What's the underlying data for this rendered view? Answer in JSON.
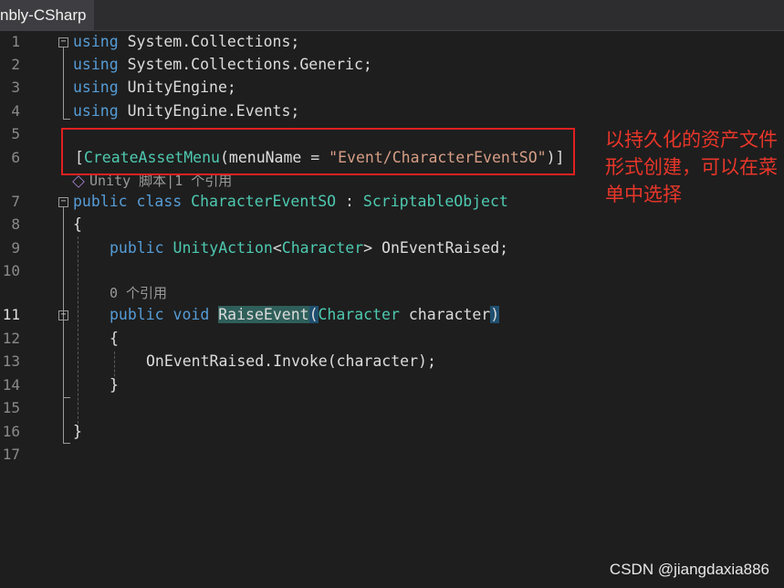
{
  "tab": {
    "title": "nbly-CSharp"
  },
  "lines": [
    {
      "n": "1"
    },
    {
      "n": "2"
    },
    {
      "n": "3"
    },
    {
      "n": "4"
    },
    {
      "n": "5"
    },
    {
      "n": "6"
    },
    {
      "n": "7"
    },
    {
      "n": "8"
    },
    {
      "n": "9"
    },
    {
      "n": "10"
    },
    {
      "n": "11"
    },
    {
      "n": "12"
    },
    {
      "n": "13"
    },
    {
      "n": "14"
    },
    {
      "n": "15"
    },
    {
      "n": "16"
    },
    {
      "n": "17"
    }
  ],
  "code": {
    "l1": {
      "kw": "using",
      "rest": " System.Collections;"
    },
    "l2": {
      "kw": "using",
      "rest": " System.Collections.Generic;"
    },
    "l3": {
      "kw": "using",
      "rest": " UnityEngine;"
    },
    "l4": {
      "kw": "using",
      "rest": " UnityEngine.Events;"
    },
    "l6": {
      "open": "[",
      "attr": "CreateAssetMenu",
      "paren": "(menuName = ",
      "str": "\"Event/CharacterEventSO\"",
      "close": ")]"
    },
    "lens1": "Unity 脚本|1 个引用",
    "l7": {
      "kw1": "public",
      "kw2": " class ",
      "name": "CharacterEventSO",
      "sep": " : ",
      "base": "ScriptableObject"
    },
    "l8": "{",
    "l9": {
      "kw": "public ",
      "ty1": "UnityAction",
      "lt": "<",
      "ty2": "Character",
      "gt": ">",
      "rest": " OnEventRaised;"
    },
    "lens2": "0 个引用",
    "l11": {
      "kw1": "public",
      "kw2": " void ",
      "name": "RaiseEvent",
      "open": "(",
      "ty": "Character",
      "param": " character",
      "close": ")"
    },
    "l12": "{",
    "l13": {
      "obj": "OnEventRaised.",
      "method": "Invoke",
      "args": "(character);"
    },
    "l14": "}",
    "l16": "}"
  },
  "annotation": "以持久化的资产文件形式创建，可以在菜单中选择",
  "watermark": "CSDN @jiangdaxia886"
}
